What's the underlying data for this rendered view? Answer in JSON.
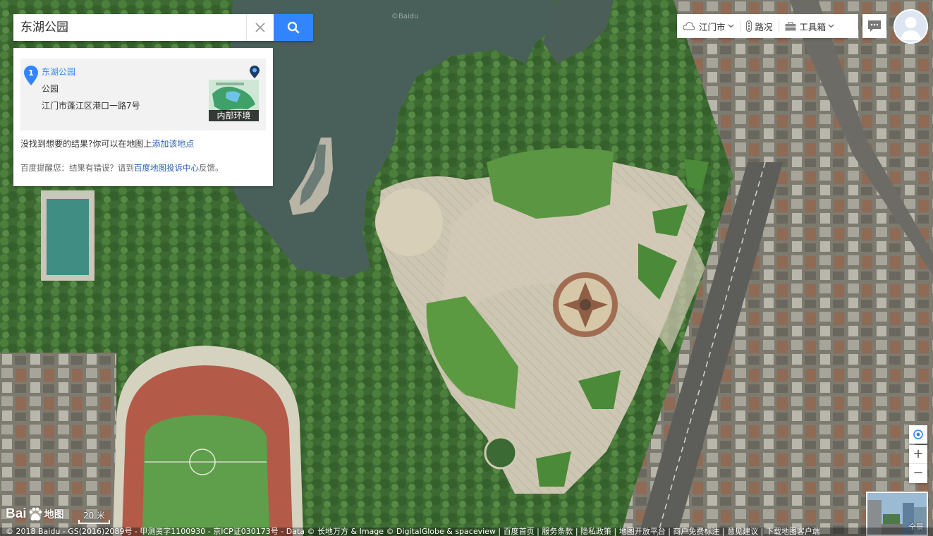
{
  "search": {
    "query": "东湖公园"
  },
  "result": {
    "index": "1",
    "name": "东湖公园",
    "category": "公园",
    "address": "江门市蓬江区港口一路7号",
    "thumb_label": "内部环境",
    "notfound_text": "没找到想要的结果?你可以在地图上",
    "notfound_link": "添加该地点",
    "tip_prefix": "百度提醒您：结果有错误？请到",
    "tip_link": "百度地图投诉中心",
    "tip_suffix": "反馈。"
  },
  "toolbar": {
    "city": "江门市",
    "traffic": "路况",
    "tools": "工具箱"
  },
  "controls": {
    "zoom_in": "+",
    "zoom_out": "−",
    "pano_label": "全景"
  },
  "map": {
    "watermark": "©Baidu",
    "scale_label": "20 米",
    "logo_bai": "Bai",
    "logo_ditu": "地图",
    "copyright": "© 2018 Baidu - GS(2016)2089号 - 甲测资字1100930 - 京ICP证030173号 - Data © 长地万方 & Image © DigitalGlobe & spaceview | 百度首页 | 服务条款 | 隐私政策 | 地图开放平台 | 商户免费标注 | 意见建议 | 下载地图客户端"
  },
  "colors": {
    "accent": "#3385ff",
    "link": "#2a5db0",
    "panel_bg": "#ffffff",
    "card_bg": "#f2f2f2"
  },
  "icons": [
    "search-icon",
    "close-icon",
    "location-marker-icon",
    "panorama-pin-icon",
    "cloud-icon",
    "traffic-light-icon",
    "toolbox-icon",
    "message-icon",
    "avatar-icon",
    "locate-icon",
    "chevron-down-icon"
  ]
}
